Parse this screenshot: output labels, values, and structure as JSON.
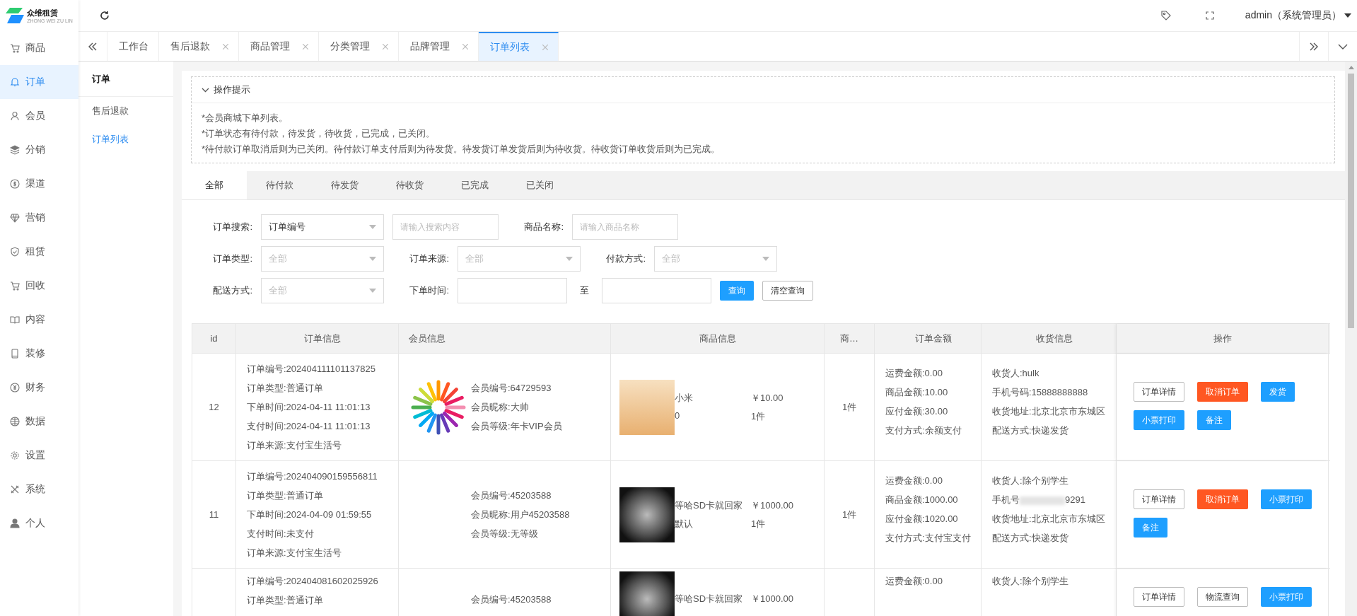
{
  "logo": {
    "text": "众维租赁",
    "subtext": "ZHONG WEI ZU LIN"
  },
  "topbar": {
    "user": "admin（系统管理员）"
  },
  "sidebar": [
    {
      "label": "商品",
      "selected": false
    },
    {
      "label": "订单",
      "selected": true
    },
    {
      "label": "会员",
      "selected": false
    },
    {
      "label": "分销",
      "selected": false
    },
    {
      "label": "渠道",
      "selected": false
    },
    {
      "label": "营销",
      "selected": false
    },
    {
      "label": "租赁",
      "selected": false
    },
    {
      "label": "回收",
      "selected": false
    },
    {
      "label": "内容",
      "selected": false
    },
    {
      "label": "装修",
      "selected": false
    },
    {
      "label": "财务",
      "selected": false
    },
    {
      "label": "数据",
      "selected": false
    },
    {
      "label": "设置",
      "selected": false
    },
    {
      "label": "系统",
      "selected": false
    },
    {
      "label": "个人",
      "selected": false
    }
  ],
  "tabs": [
    {
      "label": "工作台",
      "closable": false,
      "selected": false
    },
    {
      "label": "售后退款",
      "closable": true,
      "selected": false
    },
    {
      "label": "商品管理",
      "closable": true,
      "selected": false
    },
    {
      "label": "分类管理",
      "closable": true,
      "selected": false
    },
    {
      "label": "品牌管理",
      "closable": true,
      "selected": false
    },
    {
      "label": "订单列表",
      "closable": true,
      "selected": true
    }
  ],
  "submenu": {
    "title": "订单",
    "items": [
      {
        "label": "售后退款",
        "selected": false
      },
      {
        "label": "订单列表",
        "selected": true
      }
    ]
  },
  "tips": {
    "title": "操作提示",
    "expanded": true,
    "lines": [
      "*会员商城下单列表。",
      "*订单状态有待付款，待发货，待收货，已完成，已关闭。",
      "*待付款订单取消后则为已关闭。待付款订单支付后则为待发货。待发货订单发货后则为待收货。待收货订单收货后则为已完成。"
    ]
  },
  "status_tabs": [
    {
      "label": "全部",
      "selected": true
    },
    {
      "label": "待付款",
      "selected": false
    },
    {
      "label": "待发货",
      "selected": false
    },
    {
      "label": "待收货",
      "selected": false
    },
    {
      "label": "已完成",
      "selected": false
    },
    {
      "label": "已关闭",
      "selected": false
    }
  ],
  "filters": [
    [
      {
        "kind": "label",
        "text": "订单搜索:"
      },
      {
        "kind": "select",
        "value": "订单编号"
      },
      {
        "kind": "input",
        "placeholder": "请输入搜索内容"
      },
      {
        "kind": "label",
        "text": "商品名称:"
      },
      {
        "kind": "input",
        "placeholder": "请输入商品名称"
      }
    ],
    [
      {
        "kind": "label",
        "text": "订单类型:"
      },
      {
        "kind": "select",
        "placeholder": "全部"
      },
      {
        "kind": "label",
        "text": "订单来源:"
      },
      {
        "kind": "select",
        "placeholder": "全部"
      },
      {
        "kind": "label",
        "text": "付款方式:"
      },
      {
        "kind": "select",
        "placeholder": "全部"
      }
    ],
    [
      {
        "kind": "label",
        "text": "配送方式:"
      },
      {
        "kind": "select",
        "placeholder": "全部"
      },
      {
        "kind": "label",
        "text": "下单时间:"
      },
      {
        "kind": "input"
      },
      {
        "kind": "text",
        "text": "至"
      },
      {
        "kind": "input"
      },
      {
        "kind": "primary",
        "text": "查询"
      },
      {
        "kind": "outline",
        "text": "清空查询"
      }
    ]
  ],
  "table": {
    "columns": [
      "id",
      "订单信息",
      "会员信息",
      "商品信息",
      "商…",
      "订单金额",
      "收货信息",
      "操作"
    ],
    "rows": [
      {
        "id": "12",
        "order": [
          "订单编号:202404111101137825",
          "订单类型:普通订单",
          "下单时间:2024-04-11 11:01:13",
          "支付时间:2024-04-11 11:01:13",
          "订单来源:支付宝生活号"
        ],
        "avatar": true,
        "member": [
          "会员编号:64729593",
          "会员昵称:大帅",
          "会员等级:年卡VIP会员"
        ],
        "goods": {
          "kind": "poster",
          "name": "小米",
          "price": "￥10.00",
          "spec": "0",
          "qty": "1件"
        },
        "count": "1件",
        "amount": [
          "运费金额:0.00",
          "商品金额:10.00",
          "应付金额:30.00",
          "支付方式:余额支付"
        ],
        "shipping": [
          {
            "text": "收货人:hulk"
          },
          {
            "text": "手机号码:15888888888"
          },
          {
            "text": "收货地址:北京北京市东城区"
          },
          {
            "text": "配送方式:快递发货"
          }
        ],
        "actions": [
          {
            "kind": "outline",
            "label": "订单详情"
          },
          {
            "kind": "danger",
            "label": "取消订单"
          },
          {
            "kind": "primary",
            "label": "发货"
          },
          {
            "kind": "primary",
            "label": "小票打印"
          },
          {
            "kind": "primary",
            "label": "备注"
          }
        ]
      },
      {
        "id": "11",
        "order": [
          "订单编号:202404090159556811",
          "订单类型:普通订单",
          "下单时间:2024-04-09 01:59:55",
          "支付时间:未支付",
          "订单来源:支付宝生活号"
        ],
        "avatar": false,
        "member": [
          "会员编号:45203588",
          "会员昵称:用户45203588",
          "会员等级:无等级"
        ],
        "goods": {
          "kind": "dark",
          "name": "等哈SD卡就回家",
          "price": "￥1000.00",
          "spec": "默认",
          "qty": "1件"
        },
        "count": "1件",
        "amount": [
          "运费金额:0.00",
          "商品金额:1000.00",
          "应付金额:1020.00",
          "支付方式:支付宝支付"
        ],
        "shipping": [
          {
            "text": "收货人:除个别学生"
          },
          {
            "text": "手机号",
            "blurred": true,
            "tail": "9291"
          },
          {
            "text": "收货地址:北京北京市东城区"
          },
          {
            "text": "配送方式:快递发货"
          }
        ],
        "actions": [
          {
            "kind": "outline",
            "label": "订单详情"
          },
          {
            "kind": "danger",
            "label": "取消订单"
          },
          {
            "kind": "primary",
            "label": "小票打印"
          },
          {
            "kind": "primary",
            "label": "备注"
          }
        ]
      },
      {
        "order": [
          "订单编号:202404081602025926",
          "订单类型:普通订单"
        ],
        "avatar": false,
        "member": [
          "会员编号:45203588"
        ],
        "goods": {
          "kind": "dark",
          "name": "等哈SD卡就回家",
          "price": "￥1000.00"
        },
        "amount": [
          "运费金额:0.00"
        ],
        "shipping": [
          {
            "text": "收货人:除个别学生"
          }
        ],
        "actions": [
          {
            "kind": "outline",
            "label": "订单详情"
          },
          {
            "kind": "outline",
            "label": "物流查询"
          },
          {
            "kind": "primary",
            "label": "小票打印"
          }
        ]
      }
    ]
  }
}
